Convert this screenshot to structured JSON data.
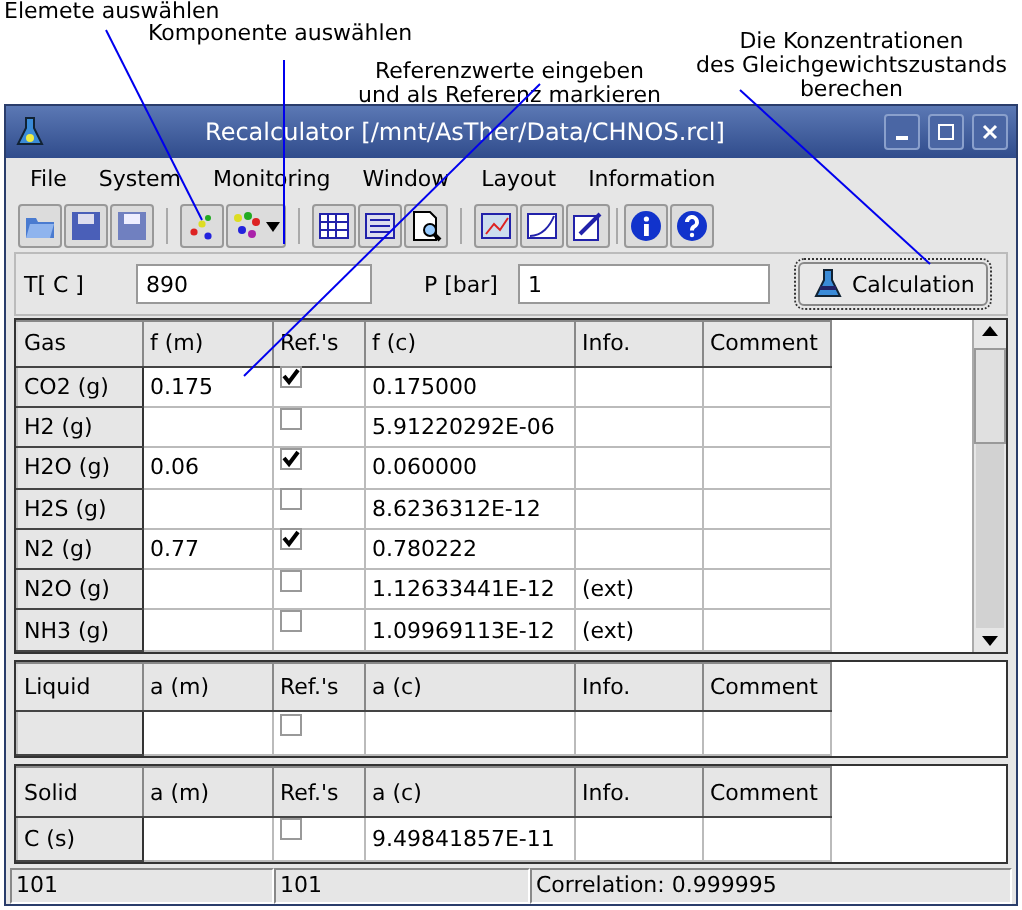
{
  "annotations": [
    {
      "text": "Elemete auswählen"
    },
    {
      "text": "Komponente auswählen"
    },
    {
      "text": "Referenzwerte eingeben\nund als Referenz markieren"
    },
    {
      "text": "Die Konzentrationen\ndes Gleichgewichtszustands\nberechen"
    }
  ],
  "window": {
    "title": "Recalculator [/mnt/AsTher/Data/CHNOS.rcl]"
  },
  "menu": [
    "File",
    "System",
    "Monitoring",
    "Window",
    "Layout",
    "Information"
  ],
  "params": {
    "temperature": {
      "label": "T[ C ]",
      "value": "890"
    },
    "pressure": {
      "label": "P [bar]",
      "value": "1"
    },
    "button": "Calculation"
  },
  "tables": [
    {
      "columns": [
        "Gas",
        "f (m)",
        "Ref.'s",
        "f (c)",
        "Info.",
        "Comment"
      ],
      "rows": [
        {
          "name": "CO2 (g)",
          "measured": "0.175",
          "reference": true,
          "calculated": "0.175000"
        },
        {
          "name": "H2 (g)",
          "reference": false,
          "calculated": "5.91220292E-06"
        },
        {
          "name": "H2O (g)",
          "measured": "0.06",
          "reference": true,
          "calculated": "0.060000"
        },
        {
          "name": "H2S (g)",
          "reference": false,
          "calculated": "8.6236312E-12"
        },
        {
          "name": "N2 (g)",
          "measured": "0.77",
          "reference": true,
          "calculated": "0.780222"
        },
        {
          "name": "N2O (g)",
          "reference": false,
          "calculated": "1.12633441E-12",
          "info": "(ext)"
        },
        {
          "name": "NH3 (g)",
          "reference": false,
          "calculated": "1.09969113E-12",
          "info": "(ext)"
        }
      ]
    },
    {
      "columns": [
        "Liquid",
        "a (m)",
        "Ref.'s",
        "a (c)",
        "Info.",
        "Comment"
      ],
      "rows": [
        {
          "reference": false
        }
      ]
    },
    {
      "columns": [
        "Solid",
        "a (m)",
        "Ref.'s",
        "a (c)",
        "Info.",
        "Comment"
      ],
      "rows": [
        {
          "name": "C (s)",
          "reference": false,
          "calculated": "9.49841857E-11"
        }
      ]
    }
  ],
  "status_bar": [
    "101",
    "101",
    "Correlation: 0.999995"
  ]
}
